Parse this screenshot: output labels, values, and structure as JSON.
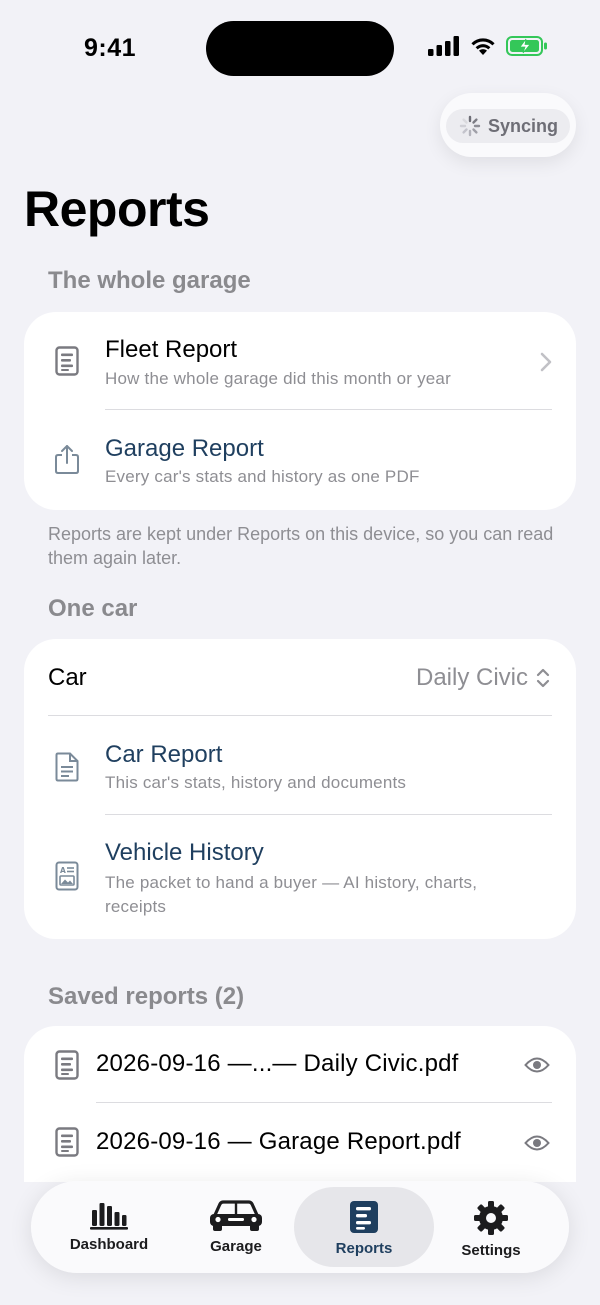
{
  "status_bar": {
    "time": "9:41"
  },
  "sync": {
    "label": "Syncing"
  },
  "page": {
    "title": "Reports"
  },
  "garage_section": {
    "header": "The whole garage",
    "rows": [
      {
        "title": "Fleet Report",
        "subtitle": "How the whole garage did this month or year",
        "icon": "document-lines-icon",
        "chevron": true
      },
      {
        "title": "Garage Report",
        "subtitle": "Every car's stats and history as one PDF",
        "icon": "share-icon",
        "chevron": false
      }
    ],
    "footnote": "Reports are kept under Reports on this device, so you can read them again later."
  },
  "car_section": {
    "header": "One car",
    "picker_label": "Car",
    "picker_value": "Daily Civic",
    "rows": [
      {
        "title": "Car Report",
        "subtitle": "This car's stats, history and documents",
        "icon": "document-icon"
      },
      {
        "title": "Vehicle History",
        "subtitle": "The packet to hand a buyer — AI history, charts, receipts",
        "icon": "history-packet-icon"
      }
    ]
  },
  "saved_section": {
    "header": "Saved reports (2)",
    "files": [
      {
        "name": "2026-09-16 —...— Daily Civic.pdf"
      },
      {
        "name": "2026-09-16 — Garage Report.pdf"
      }
    ]
  },
  "tabs": [
    {
      "label": "Dashboard",
      "icon": "bar-chart-icon",
      "active": false
    },
    {
      "label": "Garage",
      "icon": "car-icon",
      "active": false
    },
    {
      "label": "Reports",
      "icon": "report-icon",
      "active": true
    },
    {
      "label": "Settings",
      "icon": "gear-icon",
      "active": false
    }
  ],
  "colors": {
    "accent": "#1f3f5f",
    "background": "#f2f2f7",
    "secondary_text": "#8e8e93",
    "battery": "#34c759"
  }
}
